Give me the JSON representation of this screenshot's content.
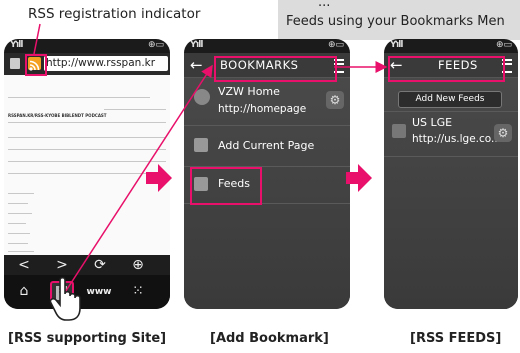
{
  "header": {
    "indicator_label": "RSS registration indicator",
    "banner_line1": "...",
    "banner_line2": "Feeds using your Bookmarks Men"
  },
  "phone1": {
    "url": "http://www.rsspan.kr",
    "page_heading": "RSSPAN.KR/RSS-KYOBE BIBLENDT PODCAST",
    "nav_row1": [
      "<",
      ">",
      "⟳",
      "⊕"
    ],
    "nav_row2": [
      "⌂",
      "",
      "www",
      "⁙"
    ],
    "caption": "[RSS supporting Site]"
  },
  "phone2": {
    "title": "BOOKMARKS",
    "items": [
      {
        "line1": "VZW Home",
        "line2": "http://homepage"
      },
      {
        "line1": "Add Current Page"
      },
      {
        "line1": "Feeds"
      }
    ],
    "caption": "[Add Bookmark]"
  },
  "phone3": {
    "title": "FEEDS",
    "add_button": "Add New Feeds",
    "items": [
      {
        "line1": "US LGE",
        "line2": "http://us.lge.co.."
      }
    ],
    "caption": "[RSS FEEDS]"
  },
  "colors": {
    "highlight": "#e8106a",
    "rss_orange": "#f4a020"
  }
}
